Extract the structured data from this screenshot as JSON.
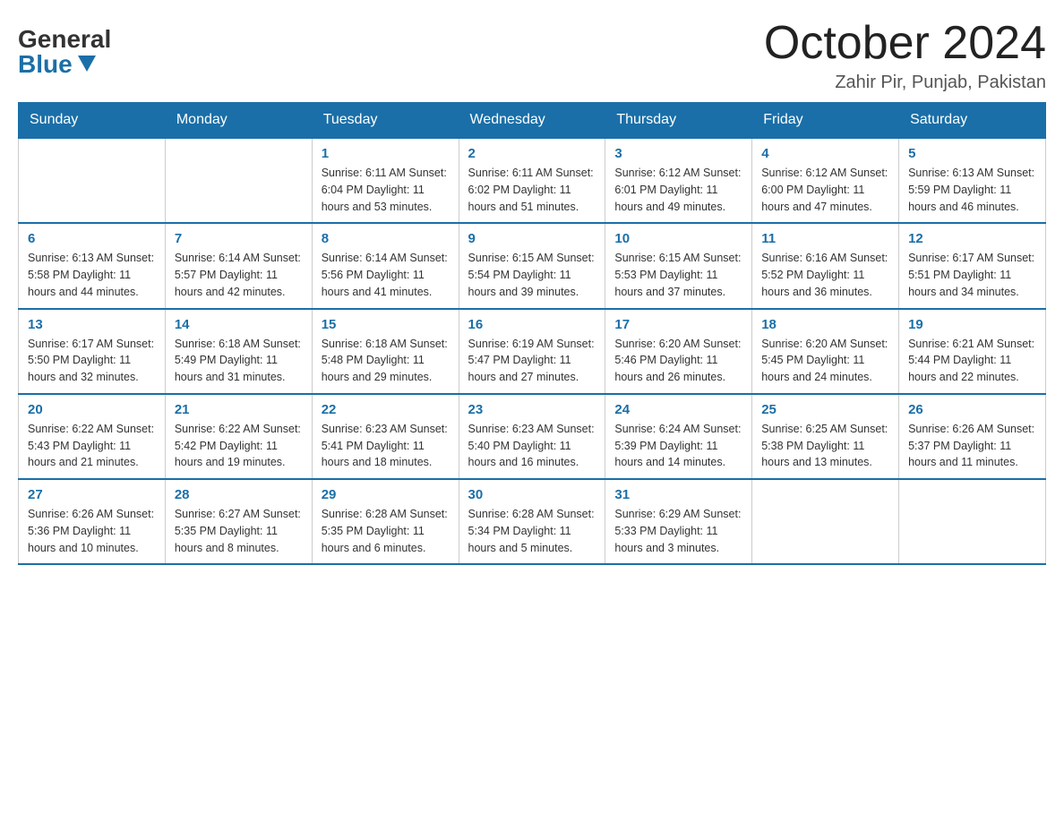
{
  "header": {
    "logo_general": "General",
    "logo_blue": "Blue",
    "month_title": "October 2024",
    "location": "Zahir Pir, Punjab, Pakistan"
  },
  "weekdays": [
    "Sunday",
    "Monday",
    "Tuesday",
    "Wednesday",
    "Thursday",
    "Friday",
    "Saturday"
  ],
  "weeks": [
    [
      {
        "day": "",
        "info": ""
      },
      {
        "day": "",
        "info": ""
      },
      {
        "day": "1",
        "info": "Sunrise: 6:11 AM\nSunset: 6:04 PM\nDaylight: 11 hours\nand 53 minutes."
      },
      {
        "day": "2",
        "info": "Sunrise: 6:11 AM\nSunset: 6:02 PM\nDaylight: 11 hours\nand 51 minutes."
      },
      {
        "day": "3",
        "info": "Sunrise: 6:12 AM\nSunset: 6:01 PM\nDaylight: 11 hours\nand 49 minutes."
      },
      {
        "day": "4",
        "info": "Sunrise: 6:12 AM\nSunset: 6:00 PM\nDaylight: 11 hours\nand 47 minutes."
      },
      {
        "day": "5",
        "info": "Sunrise: 6:13 AM\nSunset: 5:59 PM\nDaylight: 11 hours\nand 46 minutes."
      }
    ],
    [
      {
        "day": "6",
        "info": "Sunrise: 6:13 AM\nSunset: 5:58 PM\nDaylight: 11 hours\nand 44 minutes."
      },
      {
        "day": "7",
        "info": "Sunrise: 6:14 AM\nSunset: 5:57 PM\nDaylight: 11 hours\nand 42 minutes."
      },
      {
        "day": "8",
        "info": "Sunrise: 6:14 AM\nSunset: 5:56 PM\nDaylight: 11 hours\nand 41 minutes."
      },
      {
        "day": "9",
        "info": "Sunrise: 6:15 AM\nSunset: 5:54 PM\nDaylight: 11 hours\nand 39 minutes."
      },
      {
        "day": "10",
        "info": "Sunrise: 6:15 AM\nSunset: 5:53 PM\nDaylight: 11 hours\nand 37 minutes."
      },
      {
        "day": "11",
        "info": "Sunrise: 6:16 AM\nSunset: 5:52 PM\nDaylight: 11 hours\nand 36 minutes."
      },
      {
        "day": "12",
        "info": "Sunrise: 6:17 AM\nSunset: 5:51 PM\nDaylight: 11 hours\nand 34 minutes."
      }
    ],
    [
      {
        "day": "13",
        "info": "Sunrise: 6:17 AM\nSunset: 5:50 PM\nDaylight: 11 hours\nand 32 minutes."
      },
      {
        "day": "14",
        "info": "Sunrise: 6:18 AM\nSunset: 5:49 PM\nDaylight: 11 hours\nand 31 minutes."
      },
      {
        "day": "15",
        "info": "Sunrise: 6:18 AM\nSunset: 5:48 PM\nDaylight: 11 hours\nand 29 minutes."
      },
      {
        "day": "16",
        "info": "Sunrise: 6:19 AM\nSunset: 5:47 PM\nDaylight: 11 hours\nand 27 minutes."
      },
      {
        "day": "17",
        "info": "Sunrise: 6:20 AM\nSunset: 5:46 PM\nDaylight: 11 hours\nand 26 minutes."
      },
      {
        "day": "18",
        "info": "Sunrise: 6:20 AM\nSunset: 5:45 PM\nDaylight: 11 hours\nand 24 minutes."
      },
      {
        "day": "19",
        "info": "Sunrise: 6:21 AM\nSunset: 5:44 PM\nDaylight: 11 hours\nand 22 minutes."
      }
    ],
    [
      {
        "day": "20",
        "info": "Sunrise: 6:22 AM\nSunset: 5:43 PM\nDaylight: 11 hours\nand 21 minutes."
      },
      {
        "day": "21",
        "info": "Sunrise: 6:22 AM\nSunset: 5:42 PM\nDaylight: 11 hours\nand 19 minutes."
      },
      {
        "day": "22",
        "info": "Sunrise: 6:23 AM\nSunset: 5:41 PM\nDaylight: 11 hours\nand 18 minutes."
      },
      {
        "day": "23",
        "info": "Sunrise: 6:23 AM\nSunset: 5:40 PM\nDaylight: 11 hours\nand 16 minutes."
      },
      {
        "day": "24",
        "info": "Sunrise: 6:24 AM\nSunset: 5:39 PM\nDaylight: 11 hours\nand 14 minutes."
      },
      {
        "day": "25",
        "info": "Sunrise: 6:25 AM\nSunset: 5:38 PM\nDaylight: 11 hours\nand 13 minutes."
      },
      {
        "day": "26",
        "info": "Sunrise: 6:26 AM\nSunset: 5:37 PM\nDaylight: 11 hours\nand 11 minutes."
      }
    ],
    [
      {
        "day": "27",
        "info": "Sunrise: 6:26 AM\nSunset: 5:36 PM\nDaylight: 11 hours\nand 10 minutes."
      },
      {
        "day": "28",
        "info": "Sunrise: 6:27 AM\nSunset: 5:35 PM\nDaylight: 11 hours\nand 8 minutes."
      },
      {
        "day": "29",
        "info": "Sunrise: 6:28 AM\nSunset: 5:35 PM\nDaylight: 11 hours\nand 6 minutes."
      },
      {
        "day": "30",
        "info": "Sunrise: 6:28 AM\nSunset: 5:34 PM\nDaylight: 11 hours\nand 5 minutes."
      },
      {
        "day": "31",
        "info": "Sunrise: 6:29 AM\nSunset: 5:33 PM\nDaylight: 11 hours\nand 3 minutes."
      },
      {
        "day": "",
        "info": ""
      },
      {
        "day": "",
        "info": ""
      }
    ]
  ]
}
